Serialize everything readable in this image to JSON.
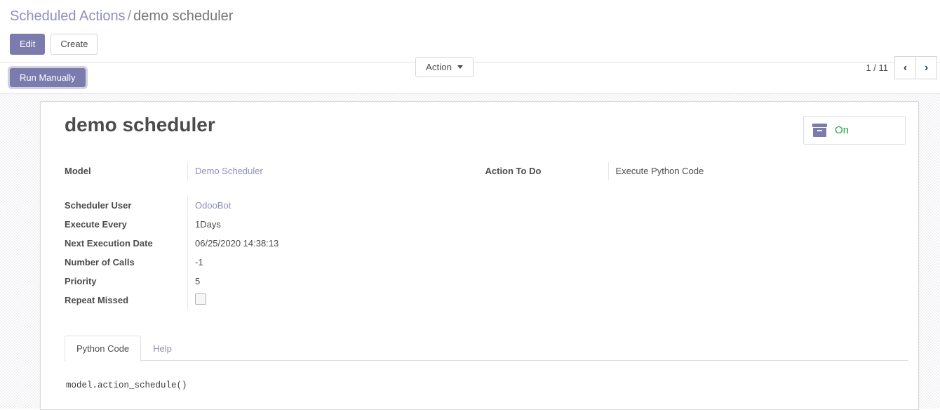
{
  "breadcrumb": {
    "root": "Scheduled Actions",
    "separator": "/",
    "current": "demo scheduler"
  },
  "control_panel": {
    "edit_label": "Edit",
    "create_label": "Create",
    "action_label": "Action",
    "pager_value": "1 / 11",
    "prev_icon": "‹",
    "next_icon": "›"
  },
  "object_buttons": {
    "run_manually_label": "Run Manually"
  },
  "record": {
    "title": "demo scheduler",
    "status_button": {
      "icon": "archive-icon",
      "label": "On",
      "color": "#28a745"
    },
    "fields_left": [
      {
        "label": "Model",
        "value": "Demo Scheduler",
        "type": "link"
      }
    ],
    "fields_left_2": [
      {
        "label": "Scheduler User",
        "value": "OdooBot",
        "type": "link"
      },
      {
        "label": "Execute Every",
        "value": "1Days",
        "type": "text"
      },
      {
        "label": "Next Execution Date",
        "value": "06/25/2020 14:38:13",
        "type": "text"
      },
      {
        "label": "Number of Calls",
        "value": "-1",
        "type": "text"
      },
      {
        "label": "Priority",
        "value": "5",
        "type": "text"
      },
      {
        "label": "Repeat Missed",
        "value": "",
        "type": "checkbox",
        "checked": false
      }
    ],
    "fields_right": [
      {
        "label": "Action To Do",
        "value": "Execute Python Code",
        "type": "text"
      }
    ],
    "notebook": {
      "tabs": [
        {
          "label": "Python Code",
          "active": true
        },
        {
          "label": "Help",
          "active": false
        }
      ],
      "python_code": "model.action_schedule()"
    }
  },
  "colors": {
    "primary": "#7c7bad",
    "link": "#8f8fbb",
    "success": "#28a745",
    "text": "#4c4c4c"
  }
}
